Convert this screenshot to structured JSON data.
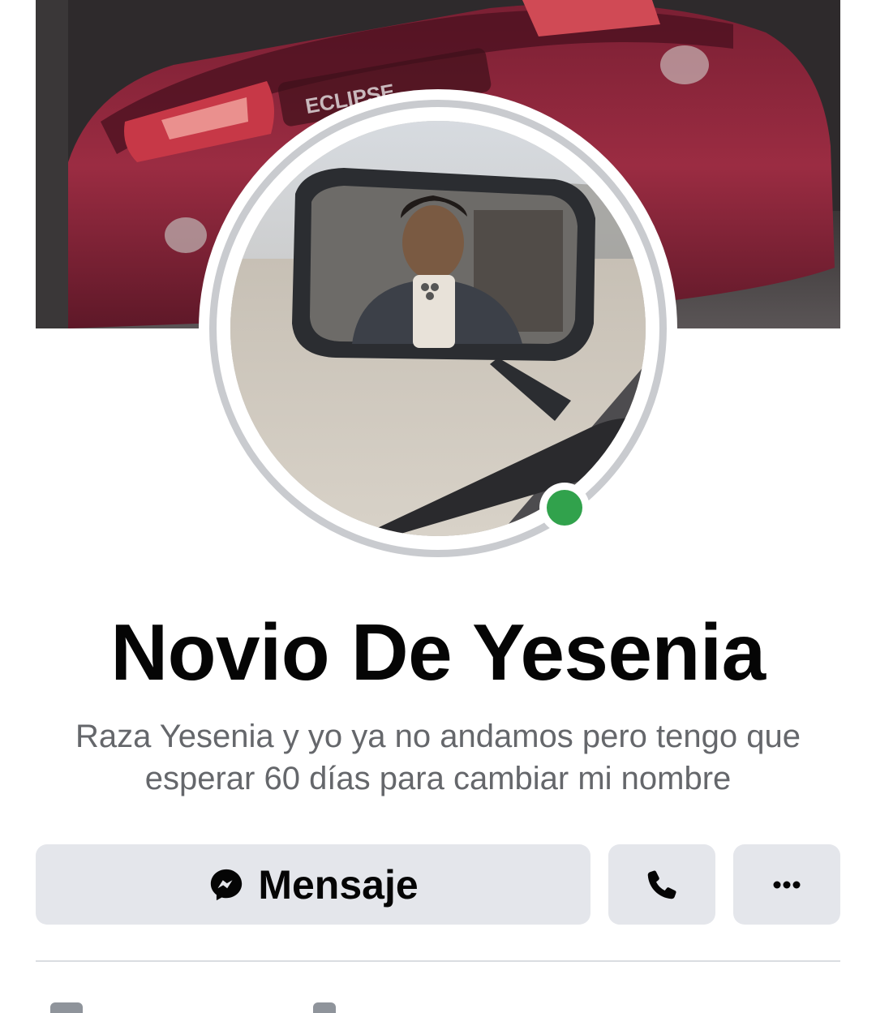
{
  "profile": {
    "name": "Novio De Yesenia",
    "bio": "Raza Yesenia y yo ya no andamos pero tengo que esperar 60 días para cambiar mi nombre",
    "online": true
  },
  "cover": {
    "car_badge_text": "ECLIPSE"
  },
  "actions": {
    "message_label": "Mensaje",
    "message_icon": "messenger-icon",
    "call_icon": "phone-icon",
    "more_icon": "more-horizontal-icon"
  },
  "colors": {
    "button_bg": "#e4e6eb",
    "text_primary": "#050505",
    "text_secondary": "#65676b",
    "online_green": "#31a24c",
    "avatar_ring": "#c9cbcf"
  }
}
